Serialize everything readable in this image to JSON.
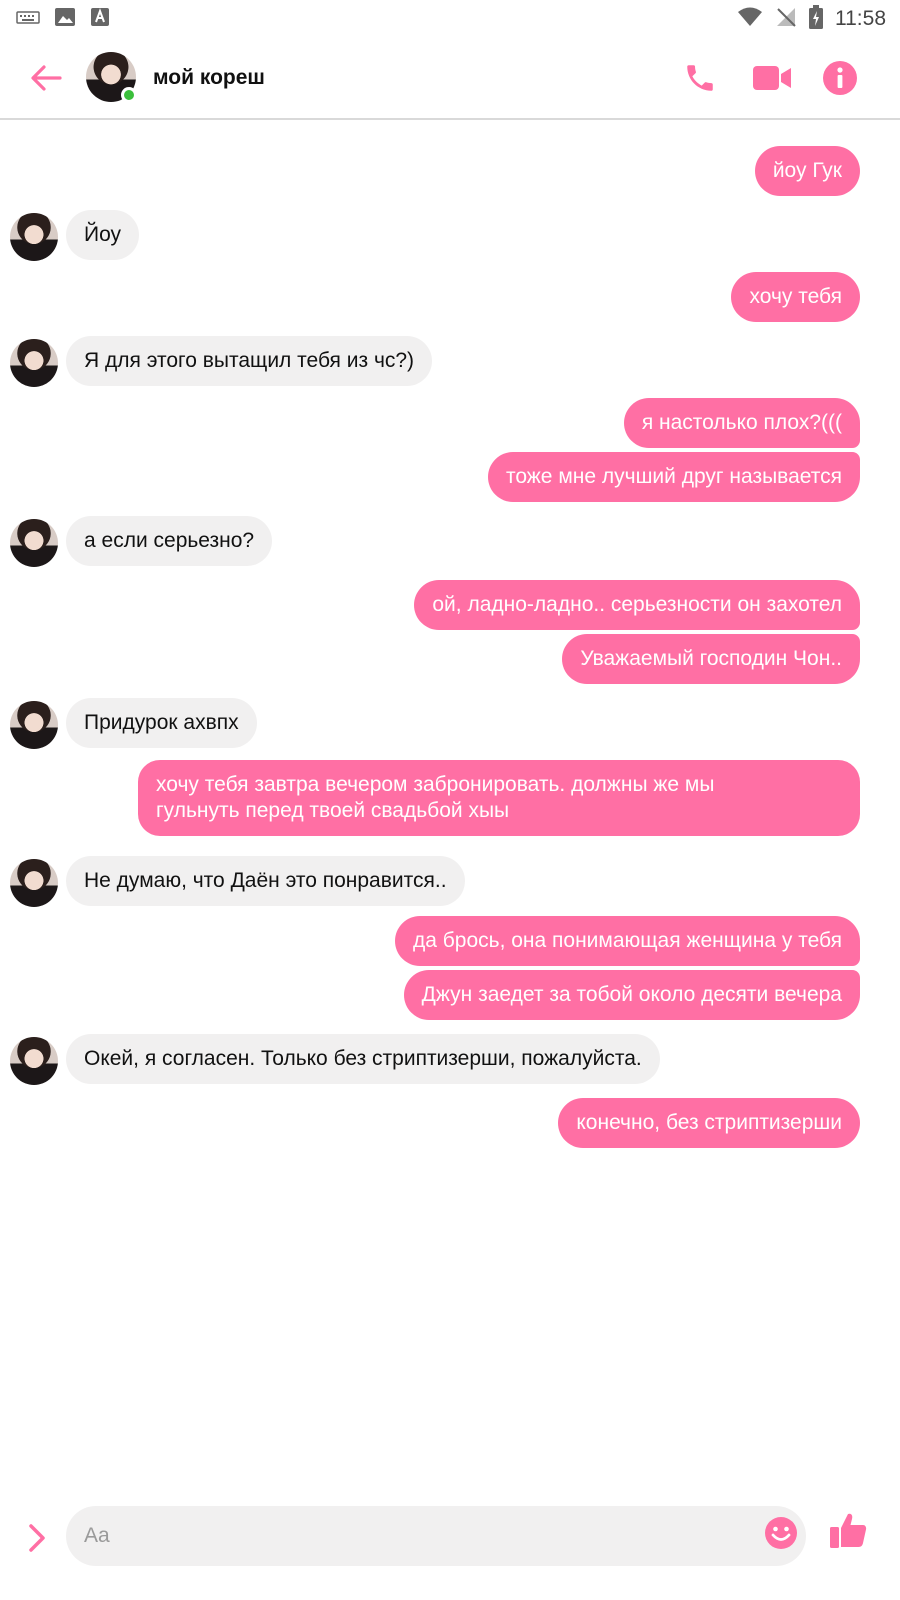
{
  "status_bar": {
    "time": "11:58",
    "left_icons": [
      "keyboard-icon",
      "image-icon",
      "font-icon"
    ],
    "right_icons": [
      "wifi-icon",
      "no-signal-icon",
      "battery-charging-icon"
    ]
  },
  "header": {
    "title": "мой кореш",
    "online": true,
    "actions": [
      "phone-icon",
      "video-icon",
      "info-icon"
    ]
  },
  "accent_color": "#ff6fa4",
  "messages": [
    {
      "dir": "out",
      "text": "йоу Гук"
    },
    {
      "dir": "in",
      "text": "Йоу"
    },
    {
      "dir": "out",
      "text": "хочу тебя"
    },
    {
      "dir": "in",
      "text": "Я для этого вытащил тебя из чс?)"
    },
    {
      "dir": "out",
      "text": "я настолько плох?((("
    },
    {
      "dir": "out",
      "text": "тоже мне лучший друг называется"
    },
    {
      "dir": "in",
      "text": "а если серьезно?"
    },
    {
      "dir": "out",
      "text": "ой, ладно-ладно.. серьезности он захотел"
    },
    {
      "dir": "out",
      "text": "Уважаемый господин Чон.."
    },
    {
      "dir": "in",
      "text": "Придурок ахвпх"
    },
    {
      "dir": "out",
      "line1": "хочу тебя завтра вечером забронировать. должны же мы",
      "line2": "гульнуть перед твоей свадьбой хыы"
    },
    {
      "dir": "in",
      "text": "Не думаю, что Даён это понравится.."
    },
    {
      "dir": "out",
      "text": "да брось, она понимающая женщина у тебя"
    },
    {
      "dir": "out",
      "text": "Джун заедет за тобой около десяти вечера"
    },
    {
      "dir": "in",
      "text": "Окей, я согласен. Только без стриптизерши, пожалуйста."
    },
    {
      "dir": "out",
      "text": "конечно, без стриптизерши"
    }
  ],
  "composer": {
    "placeholder": "Aa",
    "value": ""
  }
}
